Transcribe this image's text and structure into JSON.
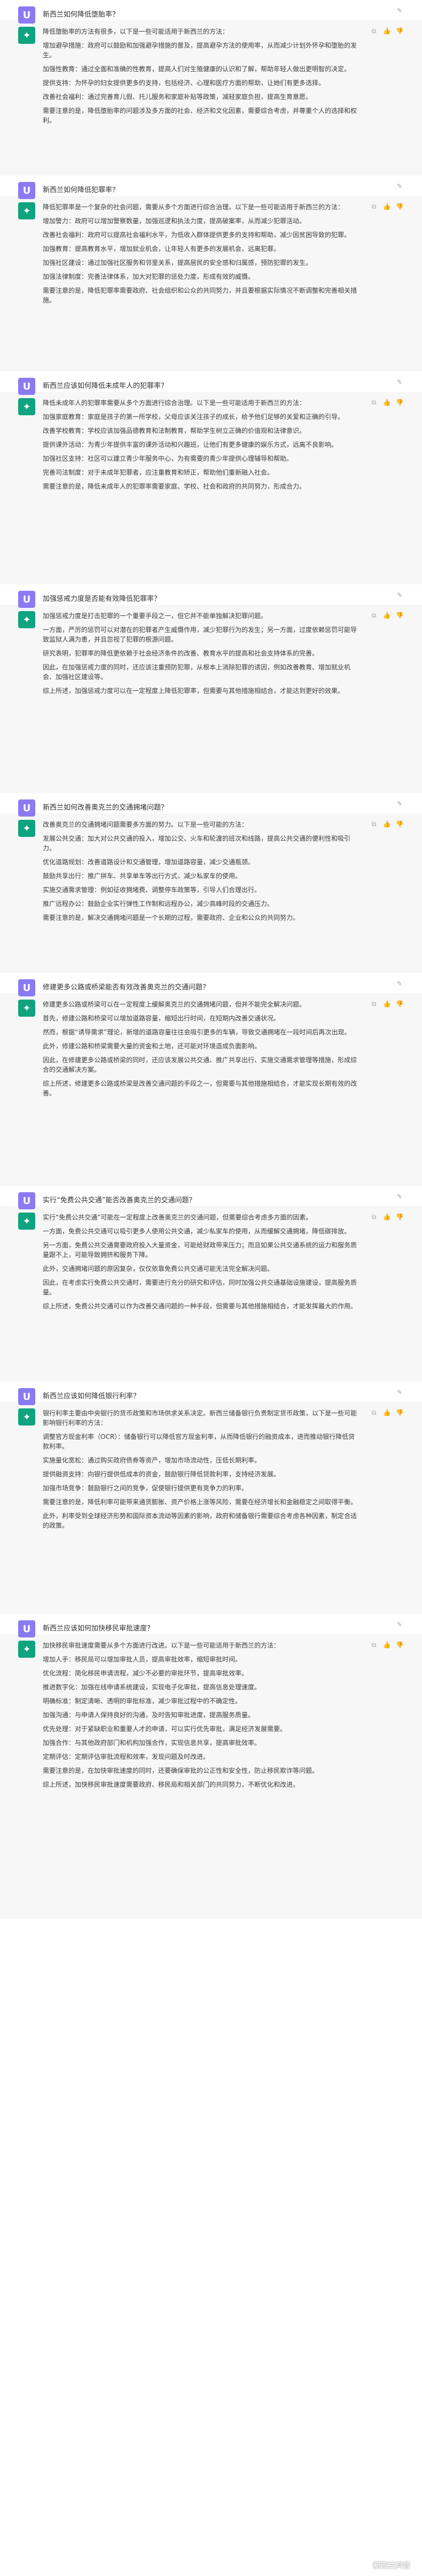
{
  "conversation": [
    {
      "q": "新西兰如何降低堕胎率？",
      "a": [
        "降低堕胎率的方法有很多，以下是一些可能适用于新西兰的方法：",
        "增加避孕措施：政府可以鼓励和加强避孕措施的普及，提高避孕方法的使用率，从而减少计划外怀孕和堕胎的发生。",
        "加强性教育：通过全面和准确的性教育，提高人们对生殖健康的认识和了解，帮助年轻人做出更明智的决定。",
        "提供支持：为怀孕的妇女提供更多的支持，包括经济、心理和医疗方面的帮助，让她们有更多选择。",
        "改善社会福利：通过完善育儿假、托儿服务和家庭补贴等政策，减轻家庭负担，提高生育意愿。",
        "需要注意的是，降低堕胎率的问题涉及多方面的社会、经济和文化因素，需要综合考虑，并尊重个人的选择和权利。"
      ]
    },
    {
      "q": "新西兰如何降低犯罪率？",
      "a": [
        "降低犯罪率是一个复杂的社会问题，需要从多个方面进行综合治理。以下是一些可能适用于新西兰的方法：",
        "增加警力：政府可以增加警察数量，加强巡逻和执法力度，提高破案率，从而减少犯罪活动。",
        "改善社会福利：政府可以提高社会福利水平，为低收入群体提供更多的支持和帮助，减少因贫困导致的犯罪。",
        "加强教育：提高教育水平，增加就业机会，让年轻人有更多的发展机会，远离犯罪。",
        "加强社区建设：通过加强社区服务和邻里关系，提高居民的安全感和归属感，预防犯罪的发生。",
        "加强法律制度：完善法律体系，加大对犯罪的惩处力度，形成有效的威慑。",
        "需要注意的是，降低犯罪率需要政府、社会组织和公众的共同努力，并且要根据实际情况不断调整和完善相关措施。"
      ]
    },
    {
      "q": "新西兰应该如何降低未成年人的犯罪率？",
      "a": [
        "降低未成年人的犯罪率需要从多个方面进行综合治理。以下是一些可能适用于新西兰的方法：",
        "加强家庭教育：家庭是孩子的第一所学校，父母应该关注孩子的成长，给予他们足够的关爱和正确的引导。",
        "改善学校教育：学校应该加强品德教育和法制教育，帮助学生树立正确的价值观和法律意识。",
        "提供课外活动：为青少年提供丰富的课外活动和兴趣班，让他们有更多健康的娱乐方式，远离不良影响。",
        "加强社区支持：社区可以建立青少年服务中心，为有需要的青少年提供心理辅导和帮助。",
        "完善司法制度：对于未成年犯罪者，应注重教育和矫正，帮助他们重新融入社会。",
        "需要注意的是，降低未成年人的犯罪率需要家庭、学校、社会和政府的共同努力，形成合力。"
      ]
    },
    {
      "q": "加强惩戒力度是否能有效降低犯罪率？",
      "a": [
        "加强惩戒力度是打击犯罪的一个重要手段之一，但它并不能单独解决犯罪问题。",
        "一方面，严厉的惩罚可以对潜在的犯罪者产生威慑作用，减少犯罪行为的发生；另一方面，过度依赖惩罚可能导致监狱人满为患，并且忽视了犯罪的根源问题。",
        "研究表明，犯罪率的降低更依赖于社会经济条件的改善、教育水平的提高和社会支持体系的完善。",
        "因此，在加强惩戒力度的同时，还应该注重预防犯罪，从根本上消除犯罪的诱因，例如改善教育、增加就业机会、加强社区建设等。",
        "综上所述，加强惩戒力度可以在一定程度上降低犯罪率，但需要与其他措施相结合，才能达到更好的效果。"
      ]
    },
    {
      "q": "新西兰如何改善奥克兰的交通拥堵问题？",
      "a": [
        "改善奥克兰的交通拥堵问题需要多方面的努力。以下是一些可能的方法：",
        "发展公共交通：加大对公共交通的投入，增加公交、火车和轮渡的班次和线路，提高公共交通的便利性和吸引力。",
        "优化道路规划：改善道路设计和交通管理，增加道路容量，减少交通瓶颈。",
        "鼓励共享出行：推广拼车、共享单车等出行方式，减少私家车的使用。",
        "实施交通需求管理：例如征收拥堵费、调整停车政策等，引导人们合理出行。",
        "推广远程办公：鼓励企业实行弹性工作制和远程办公，减少高峰时段的交通压力。",
        "需要注意的是，解决交通拥堵问题是一个长期的过程，需要政府、企业和公众的共同努力。"
      ]
    },
    {
      "q": "修建更多公路或桥梁能否有效改善奥克兰的交通问题？",
      "a": [
        "修建更多公路或桥梁可以在一定程度上缓解奥克兰的交通拥堵问题，但并不能完全解决问题。",
        "首先，修建公路和桥梁可以增加道路容量，缩短出行时间，在短期内改善交通状况。",
        "然而，根据“诱导需求”理论，新增的道路容量往往会吸引更多的车辆，导致交通拥堵在一段时间后再次出现。",
        "此外，修建公路和桥梁需要大量的资金和土地，还可能对环境造成负面影响。",
        "因此，在修建更多公路或桥梁的同时，还应该发展公共交通、推广共享出行、实施交通需求管理等措施，形成综合的交通解决方案。",
        "综上所述，修建更多公路或桥梁是改善交通问题的手段之一，但需要与其他措施相结合，才能实现长期有效的改善。"
      ]
    },
    {
      "q": "实行“免费公共交通”能否改善奥克兰的交通问题？",
      "a": [
        "实行“免费公共交通”可能在一定程度上改善奥克兰的交通问题，但需要综合考虑多方面的因素。",
        "一方面，免费公共交通可以吸引更多人使用公共交通，减少私家车的使用，从而缓解交通拥堵，降低碳排放。",
        "另一方面，免费公共交通需要政府投入大量资金，可能给财政带来压力；而且如果公共交通系统的运力和服务质量跟不上，可能导致拥挤和服务下降。",
        "此外，交通拥堵问题的原因复杂，仅仅依靠免费公共交通可能无法完全解决问题。",
        "因此，在考虑实行免费公共交通时，需要进行充分的研究和评估，同时加强公共交通基础设施建设，提高服务质量。",
        "综上所述，免费公共交通可以作为改善交通问题的一种手段，但需要与其他措施相结合，才能发挥最大的作用。"
      ]
    },
    {
      "q": "新西兰应该如何降低银行利率？",
      "a": [
        "银行利率主要由中央银行的货币政策和市场供求关系决定。新西兰储备银行负责制定货币政策，以下是一些可能影响银行利率的方法：",
        "调整官方现金利率（OCR）：储备银行可以降低官方现金利率，从而降低银行的融资成本，进而推动银行降低贷款利率。",
        "实施量化宽松：通过购买政府债券等资产，增加市场流动性，压低长期利率。",
        "提供融资支持：向银行提供低成本的资金，鼓励银行降低贷款利率，支持经济发展。",
        "加强市场竞争：鼓励银行之间的竞争，促使银行提供更有竞争力的利率。",
        "需要注意的是，降低利率可能带来通货膨胀、资产价格上涨等风险，需要在经济增长和金融稳定之间取得平衡。",
        "此外，利率受到全球经济形势和国际资本流动等因素的影响，政府和储备银行需要综合考虑各种因素，制定合适的政策。"
      ]
    },
    {
      "q": "新西兰应该如何加快移民审批速度？",
      "a": [
        "加快移民审批速度需要从多个方面进行改进。以下是一些可能适用于新西兰的方法：",
        "增加人手：移民局可以增加审批人员，提高审批效率，缩短审批时间。",
        "优化流程：简化移民申请流程，减少不必要的审批环节，提高审批效率。",
        "推进数字化：加强在线申请系统建设，实现电子化审批，提高信息处理速度。",
        "明确标准：制定清晰、透明的审批标准，减少审批过程中的不确定性。",
        "加强沟通：与申请人保持良好的沟通，及时告知审批进度，提高服务质量。",
        "优先处理：对于紧缺职业和重要人才的申请，可以实行优先审批，满足经济发展需要。",
        "加强合作：与其他政府部门和机构加强合作，实现信息共享，提高审批效率。",
        "定期评估：定期评估审批流程和效率，发现问题及时改进。",
        "需要注意的是，在加快审批速度的同时，还要确保审批的公正性和安全性，防止移民欺诈等问题。",
        "综上所述，加快移民审批速度需要政府、移民局和相关部门的共同努力，不断优化和改进。"
      ]
    }
  ],
  "watermark": "新西兰抖音",
  "colors": {
    "user_avatar": "#8a7bf2",
    "ai_avatar": "#10a37f",
    "ai_bg": "#f7f7f8"
  },
  "icons": {
    "edit": "✎",
    "copy": "⧉",
    "thumbs_up": "👍",
    "thumbs_down": "👎"
  }
}
